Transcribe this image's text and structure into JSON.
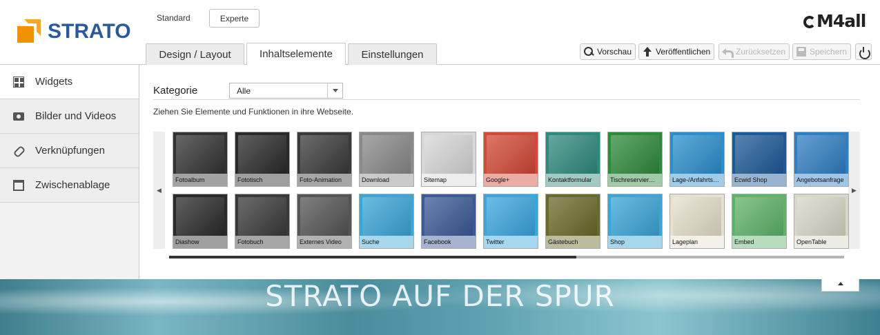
{
  "header": {
    "logo_text": "STRATO",
    "brand_right": "M4all",
    "mode_standard": "Standard",
    "mode_experte": "Experte",
    "tabs": [
      {
        "label": "Design / Layout"
      },
      {
        "label": "Inhaltselemente"
      },
      {
        "label": "Einstellungen"
      }
    ],
    "toolbar": {
      "vorschau": "Vorschau",
      "veroeffentlichen": "Veröffentlichen",
      "zuruecksetzen": "Zurücksetzen",
      "speichern": "Speichern"
    }
  },
  "sidebar": {
    "items": [
      {
        "label": "Widgets",
        "icon": "widgets-icon"
      },
      {
        "label": "Bilder und Videos",
        "icon": "camera-icon"
      },
      {
        "label": "Verknüpfungen",
        "icon": "link-icon"
      },
      {
        "label": "Zwischenablage",
        "icon": "clipboard-icon"
      }
    ]
  },
  "content": {
    "kategorie_label": "Kategorie",
    "kategorie_value": "Alle",
    "hint": "Ziehen Sie Elemente und Funktionen in ihre Webseite.",
    "tiles": [
      {
        "label": "Fotoalbum",
        "bg": "#333333",
        "icon": "photo-album-icon"
      },
      {
        "label": "Fototisch",
        "bg": "#2a2a2a",
        "icon": "photo-table-icon"
      },
      {
        "label": "Foto-Animation",
        "bg": "#3a3a3a",
        "icon": "photo-animation-icon"
      },
      {
        "label": "Download",
        "bg": "#8a8a8a",
        "icon": "download-icon"
      },
      {
        "label": "Sitemap",
        "bg": "#d8d8d8",
        "icon": "sitemap-icon"
      },
      {
        "label": "Google+",
        "bg": "#d34836",
        "icon": "google-plus-icon"
      },
      {
        "label": "Kontaktformular",
        "bg": "#2f8a7e",
        "icon": "contact-form-icon"
      },
      {
        "label": "Tischreservier…",
        "bg": "#2e8b3c",
        "icon": "table-reservation-icon"
      },
      {
        "label": "Lage-/Anfahrts…",
        "bg": "#2b8fcf",
        "icon": "world-map-icon"
      },
      {
        "label": "Ecwid Shop",
        "bg": "#1d5a99",
        "icon": "ecwid-icon"
      },
      {
        "label": "Angebotsanfrage",
        "bg": "#2f7fc4",
        "icon": "quote-request-icon"
      },
      {
        "label": "Diashow",
        "bg": "#2a2a2a",
        "icon": "slideshow-icon"
      },
      {
        "label": "Fotobuch",
        "bg": "#3a3a3a",
        "icon": "photo-book-icon"
      },
      {
        "label": "Externes Video",
        "bg": "#555555",
        "icon": "external-video-icon"
      },
      {
        "label": "Suche",
        "bg": "#3aa6d8",
        "icon": "search-tile-icon"
      },
      {
        "label": "Facebook",
        "bg": "#3b5a98",
        "icon": "facebook-icon"
      },
      {
        "label": "Twitter",
        "bg": "#3aa6e0",
        "icon": "twitter-icon"
      },
      {
        "label": "Gästebuch",
        "bg": "#6b6a2a",
        "icon": "guestbook-icon"
      },
      {
        "label": "Shop",
        "bg": "#3aa6d8",
        "icon": "shop-cart-icon"
      },
      {
        "label": "Lageplan",
        "bg": "#e6e0cc",
        "icon": "location-map-icon"
      },
      {
        "label": "Embed",
        "bg": "#5fb46a",
        "icon": "embed-icon"
      },
      {
        "label": "OpenTable",
        "bg": "#d8d8c8",
        "icon": "opentable-icon"
      }
    ]
  },
  "banner": {
    "title": "STRATO AUF DER SPUR"
  },
  "colors": {
    "strato_blue": "#2a5a9a",
    "strato_orange": "#f39200"
  }
}
